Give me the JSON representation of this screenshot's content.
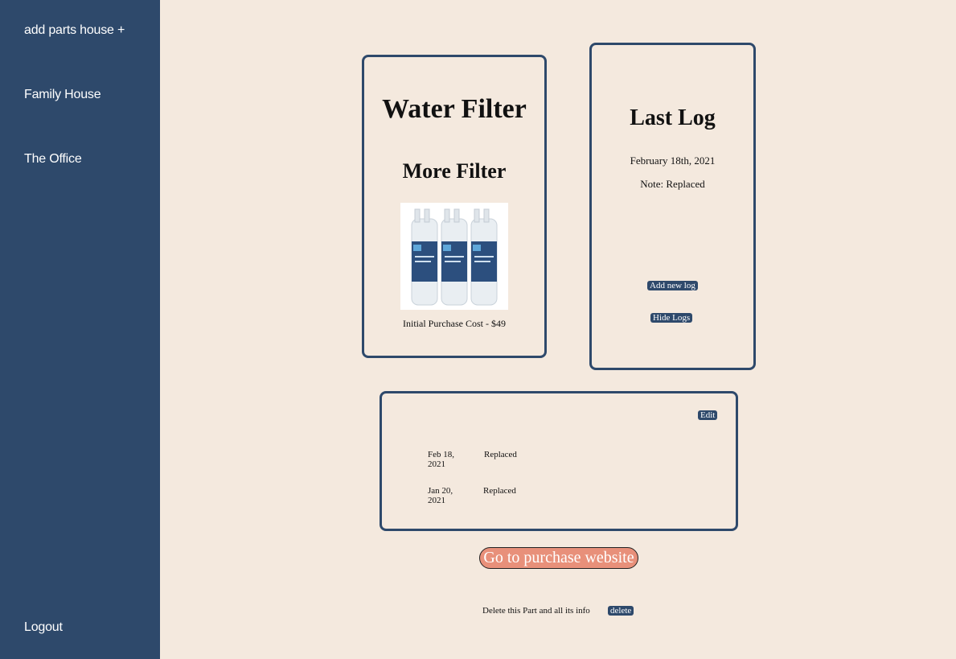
{
  "sidebar": {
    "add_house": "add parts house +",
    "houses": [
      "Family House",
      "The Office"
    ],
    "logout": "Logout"
  },
  "part": {
    "name": "Water Filter",
    "brand": "More Filter",
    "image_alt": "three water filter cartridges",
    "purchase_cost": "Initial Purchase Cost - $49"
  },
  "last_log": {
    "title": "Last Log",
    "date": "February 18th, 2021",
    "note": "Note: Replaced",
    "add_button": "Add new log",
    "hide_button": "Hide Logs"
  },
  "history": {
    "edit_button": "Edit",
    "rows": [
      {
        "date": "Feb 18, 2021",
        "note": "Replaced"
      },
      {
        "date": "Jan 20, 2021",
        "note": "Replaced"
      }
    ]
  },
  "purchase_button": "Go to purchase website",
  "delete": {
    "text": "Delete this Part and all its info",
    "button": "delete"
  },
  "colors": {
    "sidebar": "#2e496b",
    "background": "#f4e9de",
    "accent": "#e8907a"
  }
}
